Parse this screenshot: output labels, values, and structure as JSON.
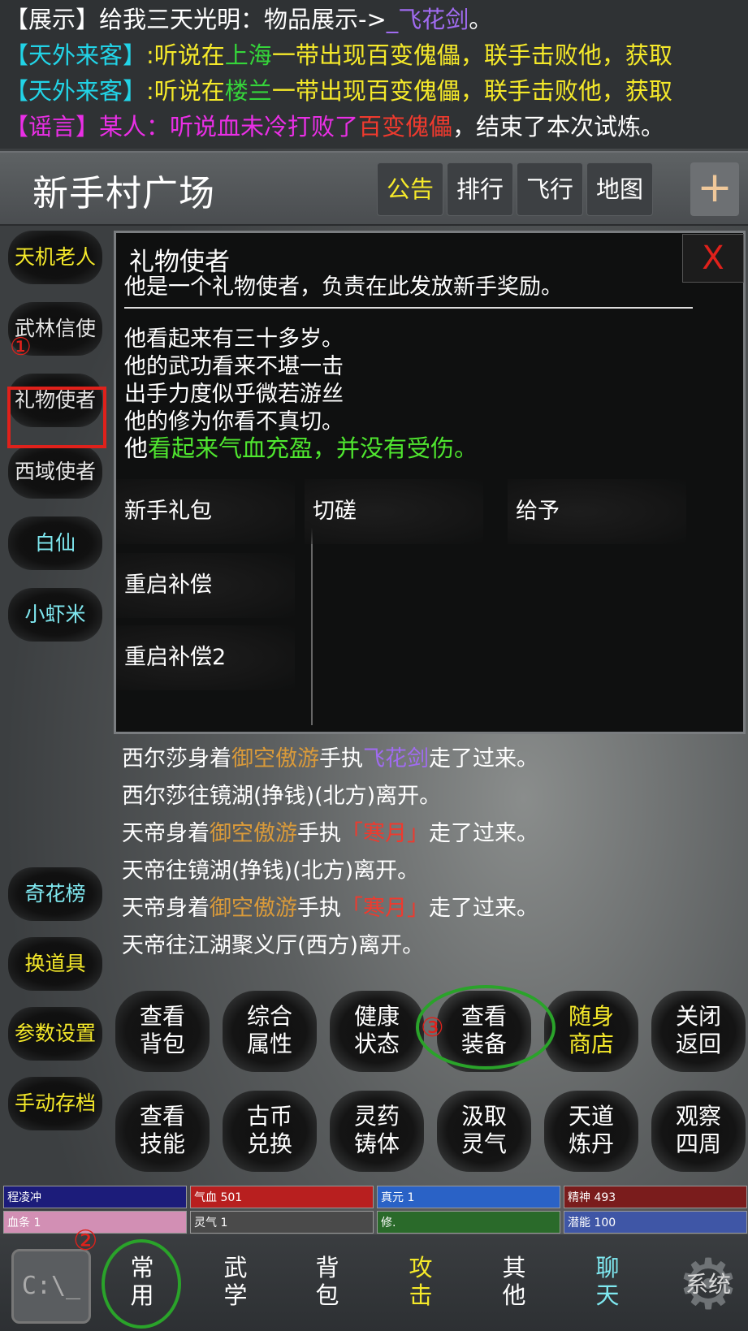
{
  "news": [
    {
      "parts": [
        {
          "text": "【展示】给我三天光明：物品展示->",
          "color": "#ffffff"
        },
        {
          "text": "_飞花剑",
          "color": "#a06bf0"
        },
        {
          "text": "。",
          "color": "#ffffff"
        }
      ]
    },
    {
      "parts": [
        {
          "text": "【天外来客】",
          "color": "#22d3e6"
        },
        {
          "text": ":听说在",
          "color": "#f5e92a"
        },
        {
          "text": "上海",
          "color": "#35d53a"
        },
        {
          "text": "一带出现百变傀儡，联手击败他，获取",
          "color": "#f5e92a"
        }
      ]
    },
    {
      "parts": [
        {
          "text": "【天外来客】",
          "color": "#22d3e6"
        },
        {
          "text": ":听说在",
          "color": "#f5e92a"
        },
        {
          "text": "楼兰",
          "color": "#35d53a"
        },
        {
          "text": "一带出现百变傀儡，联手击败他，获取",
          "color": "#f5e92a"
        }
      ]
    },
    {
      "parts": [
        {
          "text": "【谣言】某人：听说血未冷打败了",
          "color": "#ea2fe6"
        },
        {
          "text": "百变傀儡",
          "color": "#ef3a2e"
        },
        {
          "text": "，结束了本次试炼。",
          "color": "#ffffff"
        }
      ]
    }
  ],
  "header": {
    "title": "新手村广场",
    "buttons": [
      "公告",
      "排行",
      "飞行",
      "地图"
    ],
    "plus": "+"
  },
  "npcs": [
    {
      "label": "天机老人",
      "color": "#f5e92a"
    },
    {
      "label": "武林信使",
      "color": "#e6e6e6"
    },
    {
      "label": "礼物使者",
      "color": "#e6e6e6"
    },
    {
      "label": "西域使者",
      "color": "#e6e6e6"
    },
    {
      "label": "白仙",
      "color": "#7fe8f0"
    },
    {
      "label": "小虾米",
      "color": "#7fe8f0"
    }
  ],
  "side_menu": [
    {
      "label": "奇花榜",
      "color": "#7fe8f0"
    },
    {
      "label": "换道具",
      "color": "#f5e92a"
    },
    {
      "label": "参数设置",
      "color": "#f5e92a"
    },
    {
      "label": "手动存档",
      "color": "#f5e92a"
    }
  ],
  "markers": {
    "one": "①",
    "two": "②",
    "three": "③"
  },
  "dialog": {
    "name": "礼物使者",
    "close": "X",
    "intro": "他是一个礼物使者，负责在此发放新手奖励。",
    "divider": "——————————————————————————",
    "lines": [
      "他看起来有三十多岁。",
      "他的武功看来不堪一击",
      "出手力度似乎微若游丝",
      "他的修为你看不真切。"
    ],
    "health_prefix": "他",
    "health_text": "看起来气血充盈，并没有受伤。",
    "health_color": "#4fe62f",
    "left_actions": [
      "新手礼包",
      "重启补偿",
      "重启补偿2"
    ],
    "right_actions": [
      "切磋",
      "给予"
    ]
  },
  "log": [
    {
      "parts": [
        {
          "text": "西尔莎身着",
          "color": "#ffffff"
        },
        {
          "text": "御空傲游",
          "color": "#d99a3a"
        },
        {
          "text": "手执",
          "color": "#ffffff"
        },
        {
          "text": "飞花剑",
          "color": "#a06bf0"
        },
        {
          "text": "走了过来。",
          "color": "#ffffff"
        }
      ]
    },
    {
      "parts": [
        {
          "text": "西尔莎往镜湖(挣钱)(北方)离开。",
          "color": "#ffffff"
        }
      ]
    },
    {
      "parts": [
        {
          "text": "天帝身着",
          "color": "#ffffff"
        },
        {
          "text": "御空傲游",
          "color": "#d99a3a"
        },
        {
          "text": "手执",
          "color": "#ffffff"
        },
        {
          "text": "「寒月」",
          "color": "#ef3a2e"
        },
        {
          "text": "走了过来。",
          "color": "#ffffff"
        }
      ]
    },
    {
      "parts": [
        {
          "text": "天帝往镜湖(挣钱)(北方)离开。",
          "color": "#ffffff"
        }
      ]
    },
    {
      "parts": [
        {
          "text": "天帝身着",
          "color": "#ffffff"
        },
        {
          "text": "御空傲游",
          "color": "#d99a3a"
        },
        {
          "text": "手执",
          "color": "#ffffff"
        },
        {
          "text": "「寒月」",
          "color": "#ef3a2e"
        },
        {
          "text": "走了过来。",
          "color": "#ffffff"
        }
      ]
    },
    {
      "parts": [
        {
          "text": "天帝往江湖聚义厅(西方)离开。",
          "color": "#ffffff"
        }
      ]
    }
  ],
  "commands": [
    {
      "l1": "查看",
      "l2": "背包",
      "color": "#ffffff"
    },
    {
      "l1": "综合",
      "l2": "属性",
      "color": "#ffffff"
    },
    {
      "l1": "健康",
      "l2": "状态",
      "color": "#ffffff"
    },
    {
      "l1": "查看",
      "l2": "装备",
      "color": "#ffffff"
    },
    {
      "l1": "随身",
      "l2": "商店",
      "color": "#f5e92a"
    },
    {
      "l1": "关闭",
      "l2": "返回",
      "color": "#ffffff"
    },
    {
      "l1": "查看",
      "l2": "技能",
      "color": "#ffffff"
    },
    {
      "l1": "古币",
      "l2": "兑换",
      "color": "#ffffff"
    },
    {
      "l1": "灵药",
      "l2": "铸体",
      "color": "#ffffff"
    },
    {
      "l1": "汲取",
      "l2": "灵气",
      "color": "#ffffff"
    },
    {
      "l1": "天道",
      "l2": "炼丹",
      "color": "#ffffff"
    },
    {
      "l1": "观察",
      "l2": "四周",
      "color": "#ffffff"
    }
  ],
  "status": [
    {
      "text": "程凌冲",
      "color": "#1c1c7a"
    },
    {
      "text": "气血 501",
      "color": "#b81f1f"
    },
    {
      "text": "真元 1",
      "color": "#2a62c6"
    },
    {
      "text": "精神 493",
      "color": "#7a1c1c"
    },
    {
      "text": "血条 1",
      "color": "#d28fb4"
    },
    {
      "text": "灵气 1",
      "color": "#4a4a4a"
    },
    {
      "text": "修.",
      "color": "#2a6a2a"
    },
    {
      "text": "潜能 100",
      "color": "#3f56a6"
    }
  ],
  "nav": [
    {
      "l1": "常",
      "l2": "用",
      "color": "#ffffff"
    },
    {
      "l1": "武",
      "l2": "学",
      "color": "#ffffff"
    },
    {
      "l1": "背",
      "l2": "包",
      "color": "#ffffff"
    },
    {
      "l1": "攻",
      "l2": "击",
      "color": "#f5e92a"
    },
    {
      "l1": "其",
      "l2": "他",
      "color": "#ffffff"
    },
    {
      "l1": "聊",
      "l2": "天",
      "color": "#7fe8f0"
    }
  ],
  "nav_icons": {
    "cmd": "C:\\_",
    "gear": "⚙",
    "gear_label": "系统"
  }
}
